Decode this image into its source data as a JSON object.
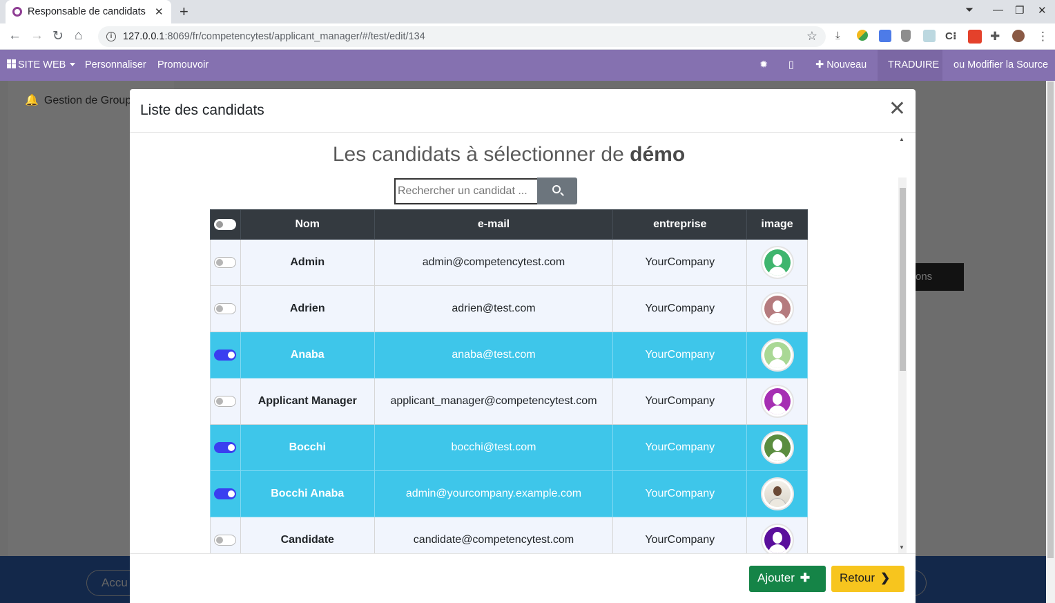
{
  "browser": {
    "tab_title": "Responsable de candidats",
    "url_host": "127.0.0.1",
    "url_rest": ":8069/fr/competencytest/applicant_manager/#/test/edit/134"
  },
  "navbar": {
    "site_web": "SITE WEB",
    "personnaliser": "Personnaliser",
    "promouvoir": "Promouvoir",
    "nouveau": "Nouveau",
    "traduire": "TRADUIRE",
    "modifier_source": "ou Modifier la Source"
  },
  "background": {
    "gestion_label": "Gestion de Groupe",
    "dark_button": "ons",
    "bottom_left": "Accu"
  },
  "modal": {
    "title": "Liste des candidats",
    "heading_prefix": "Les candidats à sélectionner de ",
    "heading_bold": "démo",
    "search_placeholder": "Rechercher un candidat ...",
    "columns": [
      "Nom",
      "e-mail",
      "entreprise",
      "image"
    ],
    "rows": [
      {
        "name": "Admin",
        "email": "admin@competencytest.com",
        "company": "YourCompany",
        "selected": false,
        "avatar_color": "#3fb56e"
      },
      {
        "name": "Adrien",
        "email": "adrien@test.com",
        "company": "YourCompany",
        "selected": false,
        "avatar_color": "#b57b7e"
      },
      {
        "name": "Anaba",
        "email": "anaba@test.com",
        "company": "YourCompany",
        "selected": true,
        "avatar_color": "#a9d895"
      },
      {
        "name": "Applicant Manager",
        "email": "applicant_manager@competencytest.com",
        "company": "YourCompany",
        "selected": false,
        "avatar_color": "#a62fb3"
      },
      {
        "name": "Bocchi",
        "email": "bocchi@test.com",
        "company": "YourCompany",
        "selected": true,
        "avatar_color": "#5a8d3f"
      },
      {
        "name": "Bocchi Anaba",
        "email": "admin@yourcompany.example.com",
        "company": "YourCompany",
        "selected": true,
        "avatar_color": "photo"
      },
      {
        "name": "Candidate",
        "email": "candidate@competencytest.com",
        "company": "YourCompany",
        "selected": false,
        "avatar_color": "#5a0f9c"
      }
    ],
    "add_label": "Ajouter",
    "back_label": "Retour"
  }
}
